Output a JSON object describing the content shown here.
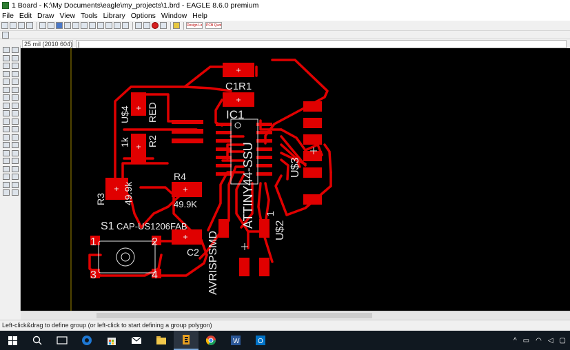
{
  "window": {
    "title": "1 Board - K:\\My Documents\\eagle\\my_projects\\1.brd - EAGLE 8.6.0 premium"
  },
  "menu": [
    "File",
    "Edit",
    "Draw",
    "View",
    "Tools",
    "Library",
    "Options",
    "Window",
    "Help"
  ],
  "toolbar": {
    "widget1": "Design Link",
    "widget2": "PCB Quote"
  },
  "coord": "25 mil (2010 604)",
  "command": "|",
  "status": "Left-click&drag to define group (or left-click to start defining a group polygon)",
  "board": {
    "labels": {
      "c1": "C1",
      "r1": "R1",
      "ic1": "IC1",
      "u4": "U$4",
      "red": "RED",
      "k1": "1k",
      "r2": "R2",
      "r3": "R3",
      "r3val": "49.9k",
      "r4": "R4",
      "r4val": "49.9K",
      "s1": "S1",
      "capname": "CAP-US1206FAB",
      "c2": "C2",
      "attiny": "ATTINY44-SSU",
      "u3": "U$3",
      "u2": "U$2",
      "one": "1",
      "avrisp": "AVRISPSMD",
      "p1": "1",
      "p2": "2",
      "p3": "3",
      "p4": "4"
    }
  },
  "colors": {
    "copper": "#e00000",
    "silkscreen": "#e8e8e8",
    "background": "#000000",
    "grid_frame": "#a08800"
  },
  "taskbar": {
    "icons": [
      "start-icon",
      "search-icon",
      "task-view-icon",
      "edge-icon",
      "store-icon",
      "mail-icon",
      "file-explorer-icon",
      "eagle-icon",
      "chrome-icon",
      "word-icon",
      "outlook-icon"
    ]
  }
}
